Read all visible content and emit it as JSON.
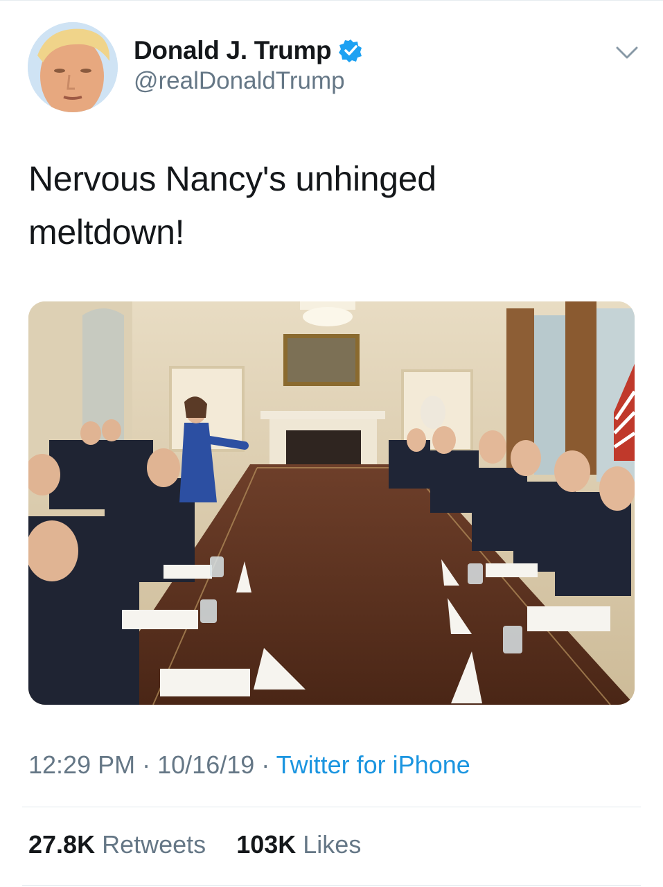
{
  "tweet": {
    "author": {
      "display_name": "Donald J. Trump",
      "handle": "@realDonaldTrump",
      "verified": true,
      "avatar_icon": "profile-photo"
    },
    "menu_icon": "chevron-down-icon",
    "text_line1": "Nervous Nancy's unhinged",
    "text_line2": "meltdown!",
    "media": {
      "kind": "photo",
      "subject": "meeting around a long conference table"
    },
    "meta": {
      "time": "12:29 PM",
      "separator": "·",
      "date": "10/16/19",
      "source": "Twitter for iPhone"
    },
    "stats": {
      "retweets_count": "27.8K",
      "retweets_label": "Retweets",
      "likes_count": "103K",
      "likes_label": "Likes"
    }
  },
  "colors": {
    "text_primary": "#14171a",
    "text_secondary": "#657786",
    "link_blue": "#1b95e0",
    "verified_blue": "#1da1f2",
    "divider": "#e1e8ed"
  }
}
